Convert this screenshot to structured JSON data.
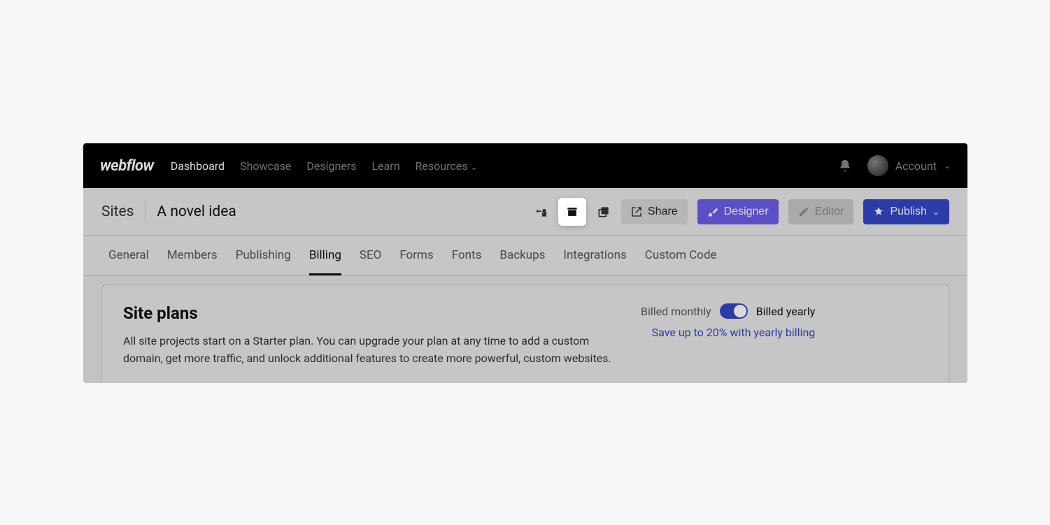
{
  "logo": "webflow",
  "nav": {
    "items": [
      "Dashboard",
      "Showcase",
      "Designers",
      "Learn",
      "Resources"
    ],
    "active_index": 0,
    "account_label": "Account"
  },
  "breadcrumb": {
    "root": "Sites",
    "title": "A novel idea"
  },
  "toolbar": {
    "share": "Share",
    "designer": "Designer",
    "editor": "Editor",
    "publish": "Publish"
  },
  "tabs": {
    "items": [
      "General",
      "Members",
      "Publishing",
      "Billing",
      "SEO",
      "Forms",
      "Fonts",
      "Backups",
      "Integrations",
      "Custom Code"
    ],
    "active_index": 3
  },
  "plans": {
    "title": "Site plans",
    "description": "All site projects start on a Starter plan. You can upgrade your plan at any time to add a custom domain, get more traffic, and unlock additional features to create more powerful, custom websites.",
    "billed_monthly": "Billed monthly",
    "billed_yearly": "Billed yearly",
    "toggle_on_yearly": true,
    "promo": "Save up to 20% with yearly billing"
  }
}
